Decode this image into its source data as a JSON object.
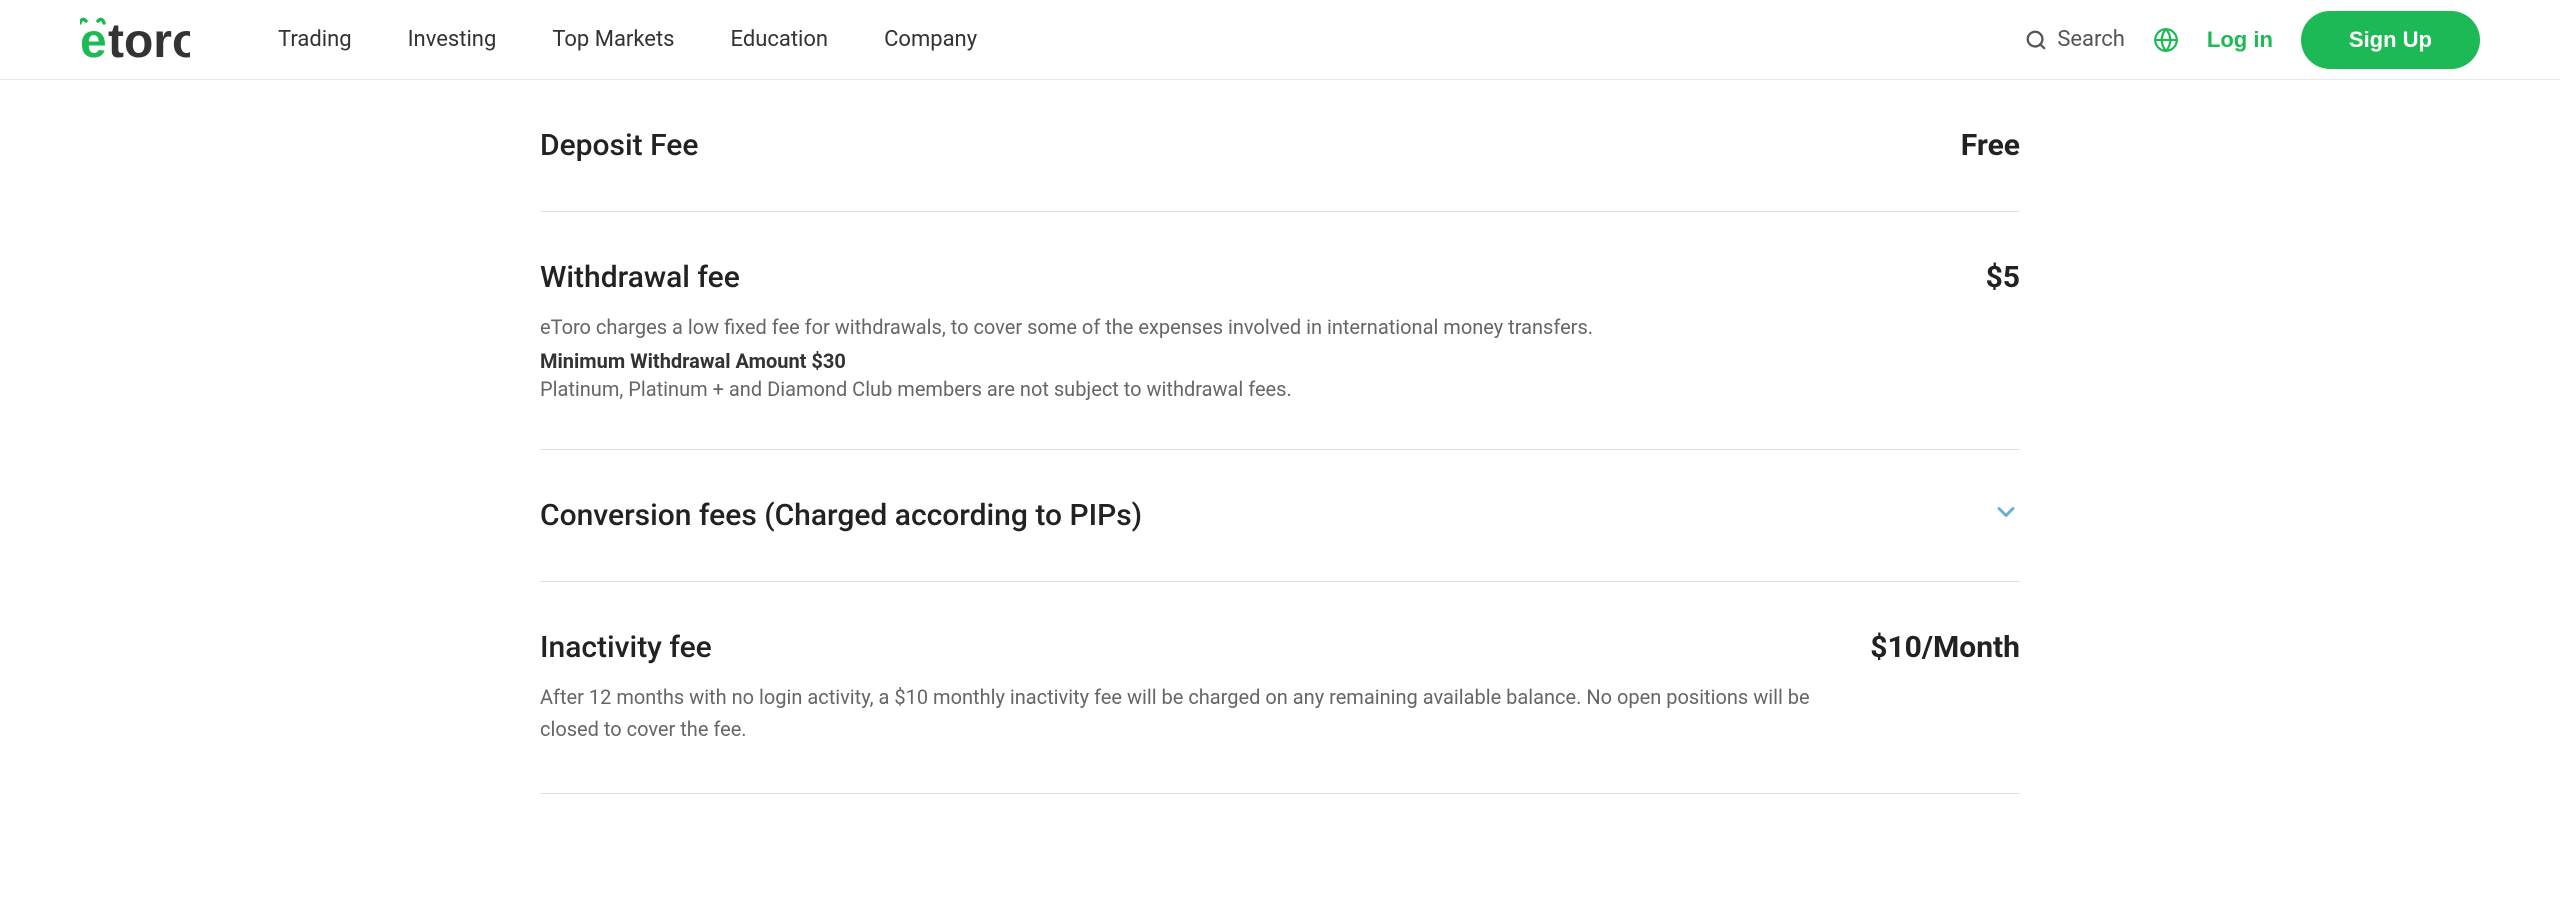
{
  "navbar": {
    "logo_text": "eToro",
    "nav_items": [
      {
        "label": "Trading",
        "id": "trading"
      },
      {
        "label": "Investing",
        "id": "investing"
      },
      {
        "label": "Top Markets",
        "id": "top-markets"
      },
      {
        "label": "Education",
        "id": "education"
      },
      {
        "label": "Company",
        "id": "company"
      }
    ],
    "search_label": "Search",
    "login_label": "Log in",
    "signup_label": "Sign Up"
  },
  "fees": [
    {
      "id": "deposit-fee",
      "title": "Deposit Fee",
      "value": "Free",
      "has_chevron": false,
      "descriptions": []
    },
    {
      "id": "withdrawal-fee",
      "title": "Withdrawal fee",
      "value": "$5",
      "has_chevron": false,
      "descriptions": [
        {
          "type": "normal",
          "text": "eToro charges a low fixed fee for withdrawals, to cover some of the expenses involved in international money transfers."
        },
        {
          "type": "bold",
          "text": "Minimum Withdrawal Amount $30"
        },
        {
          "type": "note",
          "text": "Platinum, Platinum + and Diamond Club members are not subject to withdrawal fees."
        }
      ]
    },
    {
      "id": "conversion-fee",
      "title": "Conversion fees (Charged according to PIPs)",
      "value": "",
      "has_chevron": true,
      "descriptions": []
    },
    {
      "id": "inactivity-fee",
      "title": "Inactivity fee",
      "value": "$10/Month",
      "has_chevron": false,
      "descriptions": [
        {
          "type": "normal",
          "text": "After 12 months with no login activity, a $10 monthly inactivity fee will be charged on any remaining available balance. No open positions will be closed to cover the fee."
        }
      ]
    }
  ],
  "colors": {
    "green": "#1db954",
    "chevron": "#6ab0d4"
  }
}
